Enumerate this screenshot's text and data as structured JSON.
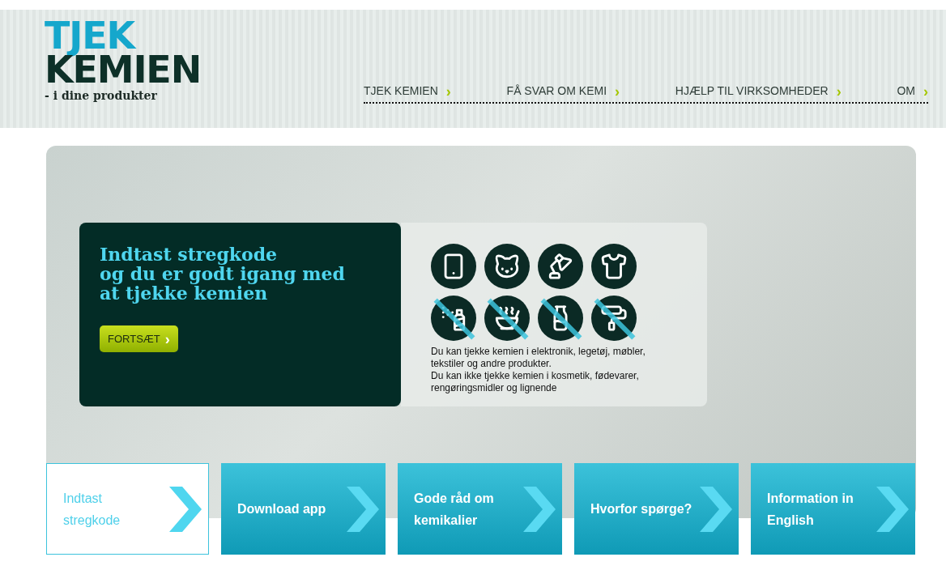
{
  "logo": {
    "line_1": "TJEK",
    "line_2": "KEMIEN",
    "tagline": "- i dine produkter"
  },
  "nav": [
    {
      "label": "TJEK KEMIEN",
      "arrow": "›"
    },
    {
      "label": "FÅ SVAR OM KEMI",
      "arrow": "›"
    },
    {
      "label": "HJÆLP TIL VIRKSOMHEDER",
      "arrow": "›"
    },
    {
      "label": "OM",
      "arrow": "›"
    }
  ],
  "hero": {
    "heading": [
      "Indtast stregkode",
      "og du er godt igang med",
      "at tjekke kemien"
    ],
    "button": "FORTSÆT",
    "button_arrow": "›",
    "categories": [
      {
        "crossed": false
      },
      {
        "crossed": false
      },
      {
        "crossed": false
      },
      {
        "crossed": false
      },
      {
        "crossed": true
      },
      {
        "crossed": true
      },
      {
        "crossed": true
      },
      {
        "crossed": true
      }
    ],
    "text_1": "Du kan tjekke kemien i elektronik, legetøj, møbler, tekstiler og andre produkter.",
    "text_2": "Du kan ikke tjekke kemien i kosmetik, fødevarer, rengøringsmidler og lignende"
  },
  "tiles": [
    {
      "label": "Indtast stregkode",
      "selected": true
    },
    {
      "label": "Download app",
      "selected": false
    },
    {
      "label": "Gode råd om kemikalier",
      "selected": false
    },
    {
      "label": "Hvorfor spørge?",
      "selected": false
    },
    {
      "label": "Information in English",
      "selected": false
    }
  ]
}
